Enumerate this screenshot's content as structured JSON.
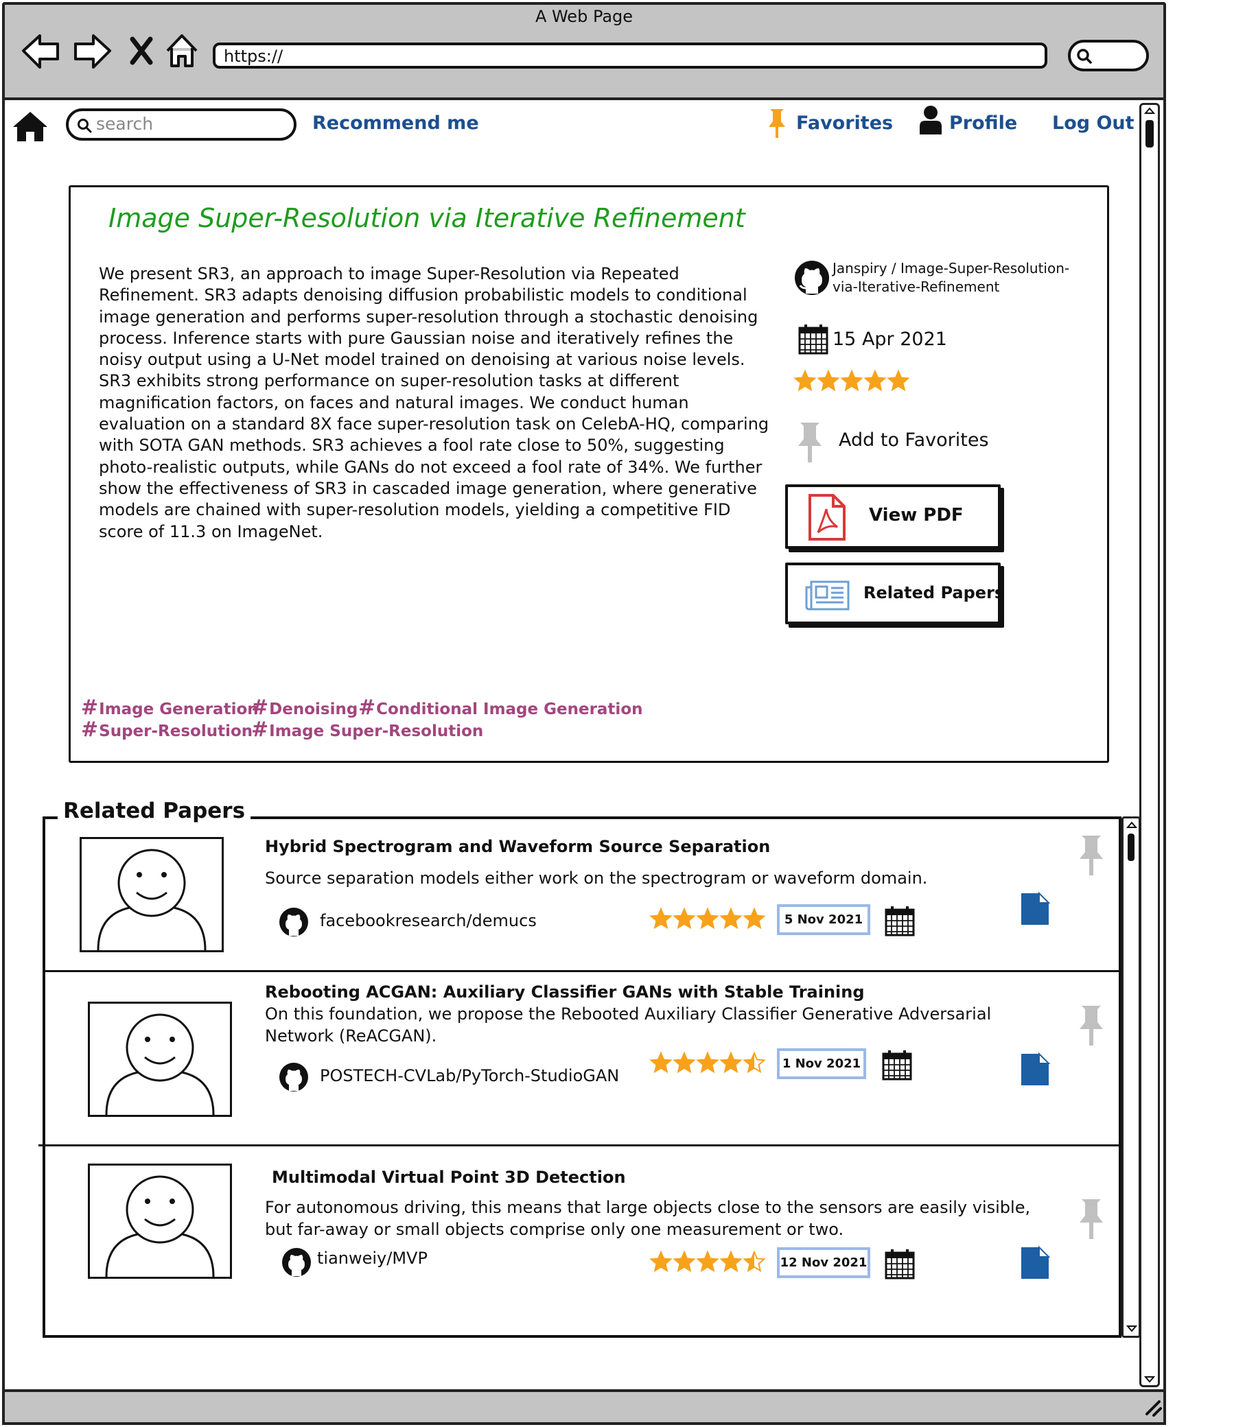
{
  "browser": {
    "window_title": "A Web Page",
    "url": "https://"
  },
  "header": {
    "search_placeholder": "search",
    "recommend_label": "Recommend me",
    "favorites_label": "Favorites",
    "profile_label": "Profile",
    "logout_label": "Log Out"
  },
  "paper": {
    "title": "Image Super-Resolution via Iterative Refinement",
    "abstract": "We present SR3, an approach to image Super-Resolution via Repeated Refinement. SR3 adapts denoising diffusion probabilistic models to conditional image generation and performs super-resolution through a stochastic denoising process. Inference starts with pure Gaussian noise and iteratively refines the noisy output using a U-Net model trained on denoising at various noise levels. SR3 exhibits strong performance on super-resolution tasks at different magnification factors, on faces and natural images. We conduct human evaluation on a standard 8X face super-resolution task on CelebA-HQ, comparing with SOTA GAN methods. SR3 achieves a fool rate close to 50%, suggesting photo-realistic outputs, while GANs do not exceed a fool rate of 34%. We further show the effectiveness of SR3 in cascaded image generation, where generative models are chained with super-resolution models, yielding a competitive FID score of 11.3 on ImageNet.",
    "repo_line1": "Janspiry / Image-Super-Resolution-",
    "repo_line2": "via-Iterative-Refinement",
    "date": "15 Apr 2021",
    "rating": 5,
    "add_favorites_label": "Add to Favorites",
    "view_pdf_label": "View PDF",
    "related_papers_label": "Related Papers",
    "tags": [
      "Image Generation",
      "Denoising",
      "Conditional Image Generation",
      "Super-Resolution",
      "Image Super-Resolution"
    ]
  },
  "related": {
    "section_title": "Related Papers",
    "items": [
      {
        "title": "Hybrid Spectrogram and Waveform Source Separation",
        "description": "Source separation models either work on the spectrogram or waveform domain.",
        "repo": "facebookresearch/demucs",
        "rating": 5,
        "date": "5 Nov 2021"
      },
      {
        "title": "Rebooting ACGAN: Auxiliary Classifier GANs with Stable Training",
        "description": "On this foundation, we propose the Rebooted Auxiliary Classifier Generative Adversarial Network (ReACGAN).",
        "repo": "POSTECH-CVLab/PyTorch-StudioGAN",
        "rating": 4.5,
        "date": "1 Nov 2021"
      },
      {
        "title": "Multimodal Virtual Point 3D Detection",
        "description": "For autonomous driving, this means that large objects close to the sensors are easily visible, but far-away or small objects comprise only one measurement or two.",
        "repo": "tianweiy/MVP",
        "rating": 4.5,
        "date": "12 Nov 2021"
      }
    ]
  },
  "colors": {
    "nav_link": "#1d4f8f",
    "title_green": "#1e9c1e",
    "tag_color": "#a2467e",
    "star_color": "#f7a21b",
    "pdf_red": "#d93a3a",
    "file_blue": "#1d5fa3",
    "pin_orange": "#f7a21b",
    "pin_grey": "#b8b8b8"
  },
  "icons": [
    "back-arrow-icon",
    "forward-arrow-icon",
    "close-icon",
    "home-icon",
    "search-icon",
    "home-icon",
    "pin-icon",
    "user-icon",
    "github-icon",
    "calendar-icon",
    "star-icon",
    "pin-icon",
    "pdf-icon",
    "newspaper-icon",
    "file-icon"
  ]
}
